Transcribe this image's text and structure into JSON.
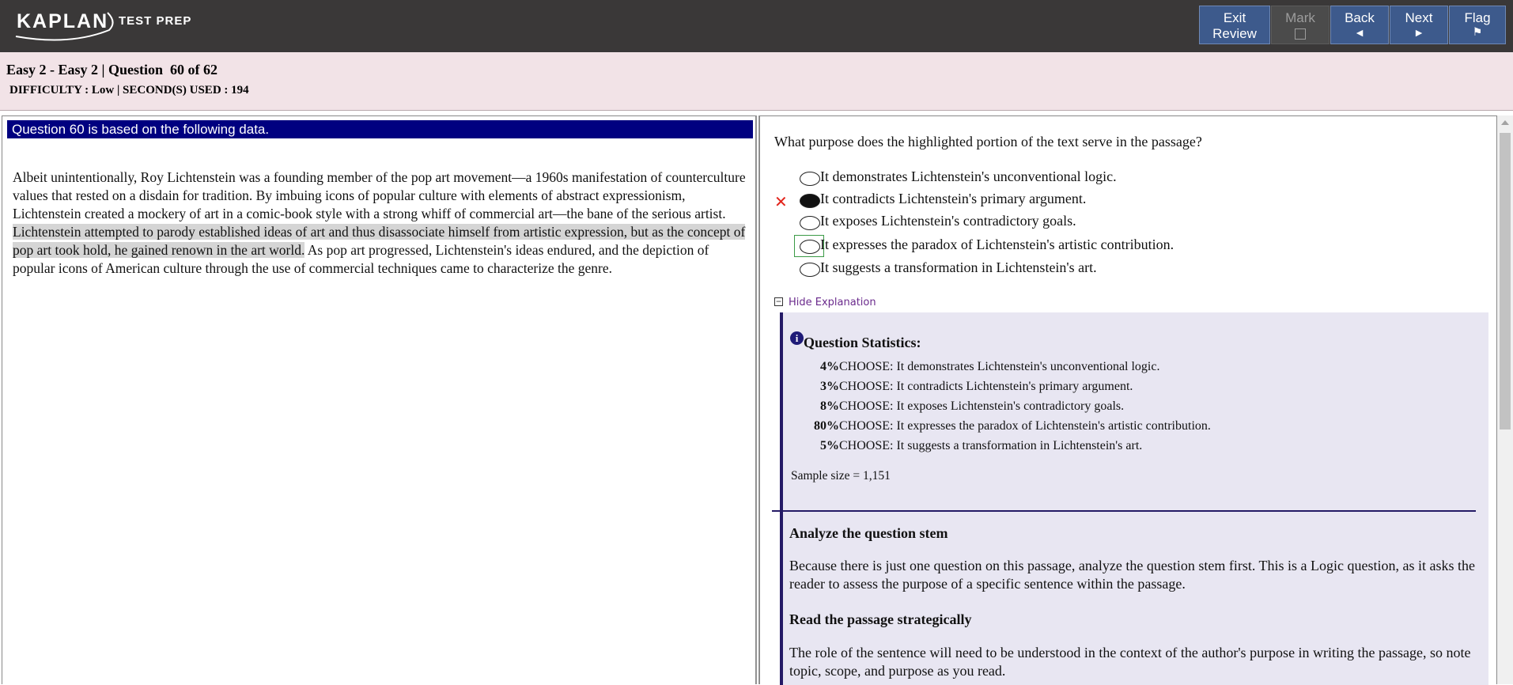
{
  "topbar": {
    "logo_brand": "KAPLAN",
    "logo_sub": "TEST PREP",
    "buttons": {
      "exit_review": {
        "line1": "Exit",
        "line2": "Review"
      },
      "mark": {
        "label": "Mark"
      },
      "back": {
        "label": "Back",
        "icon": "◄"
      },
      "next": {
        "label": "Next",
        "icon": "►"
      },
      "flag": {
        "label": "Flag",
        "icon": "⚑"
      }
    },
    "colors": {
      "bar": "#3a3838",
      "button": "#3d5a8c"
    }
  },
  "info": {
    "title": "Easy 2 - Easy 2 | Question  60 of 62",
    "meta": "DIFFICULTY : Low | SECOND(S) USED : 194"
  },
  "passage": {
    "header": "Question 60 is based on the following data.",
    "before": "Albeit unintentionally, Roy Lichtenstein was a founding member of the pop art movement—a 1960s manifestation of counterculture values that rested on a disdain for tradition. By imbuing icons of popular culture with elements of abstract expressionism, Lichtenstein created a mockery of art in a comic-book style with a strong whiff of commercial art—the bane of the serious artist. ",
    "highlight": "Lichtenstein attempted to parody established ideas of art and thus disassociate himself from artistic expression, but as the concept of pop art took hold, he gained renown in the art world.",
    "after": " As pop art progressed, Lichtenstein's ideas endured, and the depiction of popular icons of American culture through the use of commercial techniques came to characterize the genre."
  },
  "question": {
    "stem": "What purpose does the highlighted portion of the text serve in the passage?",
    "choices": [
      "It demonstrates Lichtenstein's unconventional logic.",
      "It contradicts Lichtenstein's primary argument.",
      "It exposes Lichtenstein's contradictory goals.",
      "It expresses the paradox of Lichtenstein's artistic contribution.",
      "It suggests a transformation in Lichtenstein's art."
    ],
    "selected_index": 1,
    "correct_index": 3,
    "wrong_mark": "✕"
  },
  "explanation": {
    "toggle_label": "Hide Explanation",
    "info_icon": "i",
    "stats_title": "Question Statistics:",
    "stats": [
      {
        "pct": "4%",
        "text": " CHOOSE: It demonstrates Lichtenstein's unconventional logic."
      },
      {
        "pct": "3%",
        "text": " CHOOSE: It contradicts Lichtenstein's primary argument."
      },
      {
        "pct": "8%",
        "text": " CHOOSE: It exposes Lichtenstein's contradictory goals."
      },
      {
        "pct": "80%",
        "text": " CHOOSE: It expresses the paradox of Lichtenstein's artistic contribution."
      },
      {
        "pct": "5%",
        "text": " CHOOSE: It suggests a transformation in Lichtenstein's art."
      }
    ],
    "sample_size": "Sample size = 1,151",
    "sections": [
      {
        "heading": "Analyze the question stem",
        "body": "Because there is just one question on this passage, analyze the question stem first. This is a Logic question, as it asks the reader to assess the purpose of a specific sentence within the passage."
      },
      {
        "heading": "Read the passage strategically",
        "body": "The role of the sentence will need to be understood in the context of the author's purpose in writing the passage, so note topic, scope, and purpose as you read."
      }
    ]
  }
}
